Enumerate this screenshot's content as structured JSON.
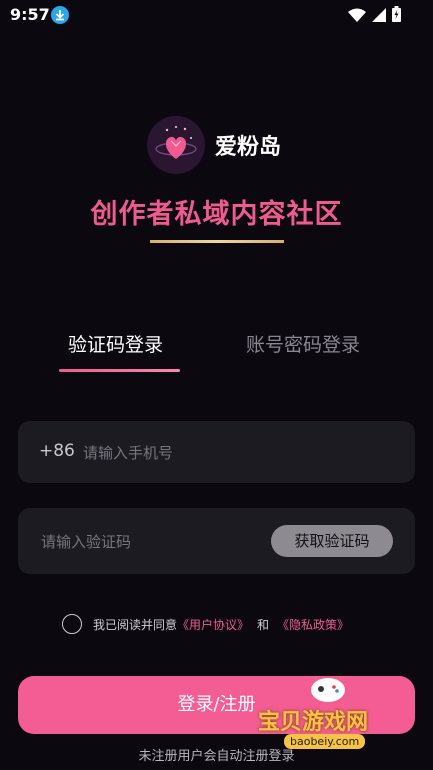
{
  "status_bar": {
    "time": "9:57"
  },
  "brand": {
    "app_name": "爱粉岛",
    "slogan": "创作者私域内容社区"
  },
  "tabs": [
    {
      "label": "验证码登录",
      "active": true
    },
    {
      "label": "账号密码登录",
      "active": false
    }
  ],
  "phone_field": {
    "country_code": "+86",
    "placeholder": "请输入手机号",
    "value": ""
  },
  "code_field": {
    "placeholder": "请输入验证码",
    "value": "",
    "get_code_label": "获取验证码"
  },
  "agreement": {
    "prefix": "我已阅读并同意",
    "user_agreement": "《用户协议》",
    "and": "和",
    "privacy_policy": "《隐私政策》",
    "checked": false
  },
  "login_button": {
    "label": "登录/注册"
  },
  "hint": "未注册用户会自动注册登录",
  "watermark": {
    "text": "宝贝游戏网",
    "url": "baobeiy.com"
  },
  "colors": {
    "background": "#0b0810",
    "accent": "#f05b8f",
    "button": "#f35d93",
    "field": "#1d1b22"
  }
}
